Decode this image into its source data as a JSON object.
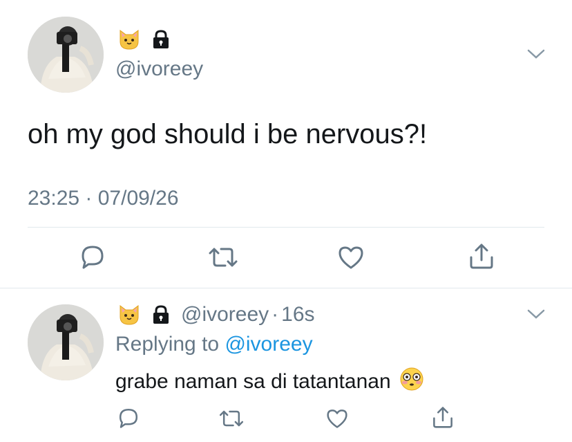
{
  "main_tweet": {
    "handle": "@ivoreey",
    "text": "oh my god should i be nervous?!",
    "timestamp": "23:25 · 07/09/26",
    "badges": [
      "cat-emoji-icon",
      "lock-icon"
    ]
  },
  "reply_tweet": {
    "handle": "@ivoreey",
    "separator": "·",
    "age": "16s",
    "replying_prefix": "Replying to",
    "replying_handle": "@ivoreey",
    "text": "grabe naman sa di tatantanan",
    "badges": [
      "cat-emoji-icon",
      "lock-icon"
    ],
    "trailing_emoji": "flushed-face-icon"
  },
  "actions": [
    "reply-icon",
    "retweet-icon",
    "like-icon",
    "share-icon"
  ],
  "colors": {
    "text": "#14171a",
    "muted": "#657786",
    "link": "#1b95e0",
    "divider": "#e1e8ed",
    "icon": "#657786"
  }
}
